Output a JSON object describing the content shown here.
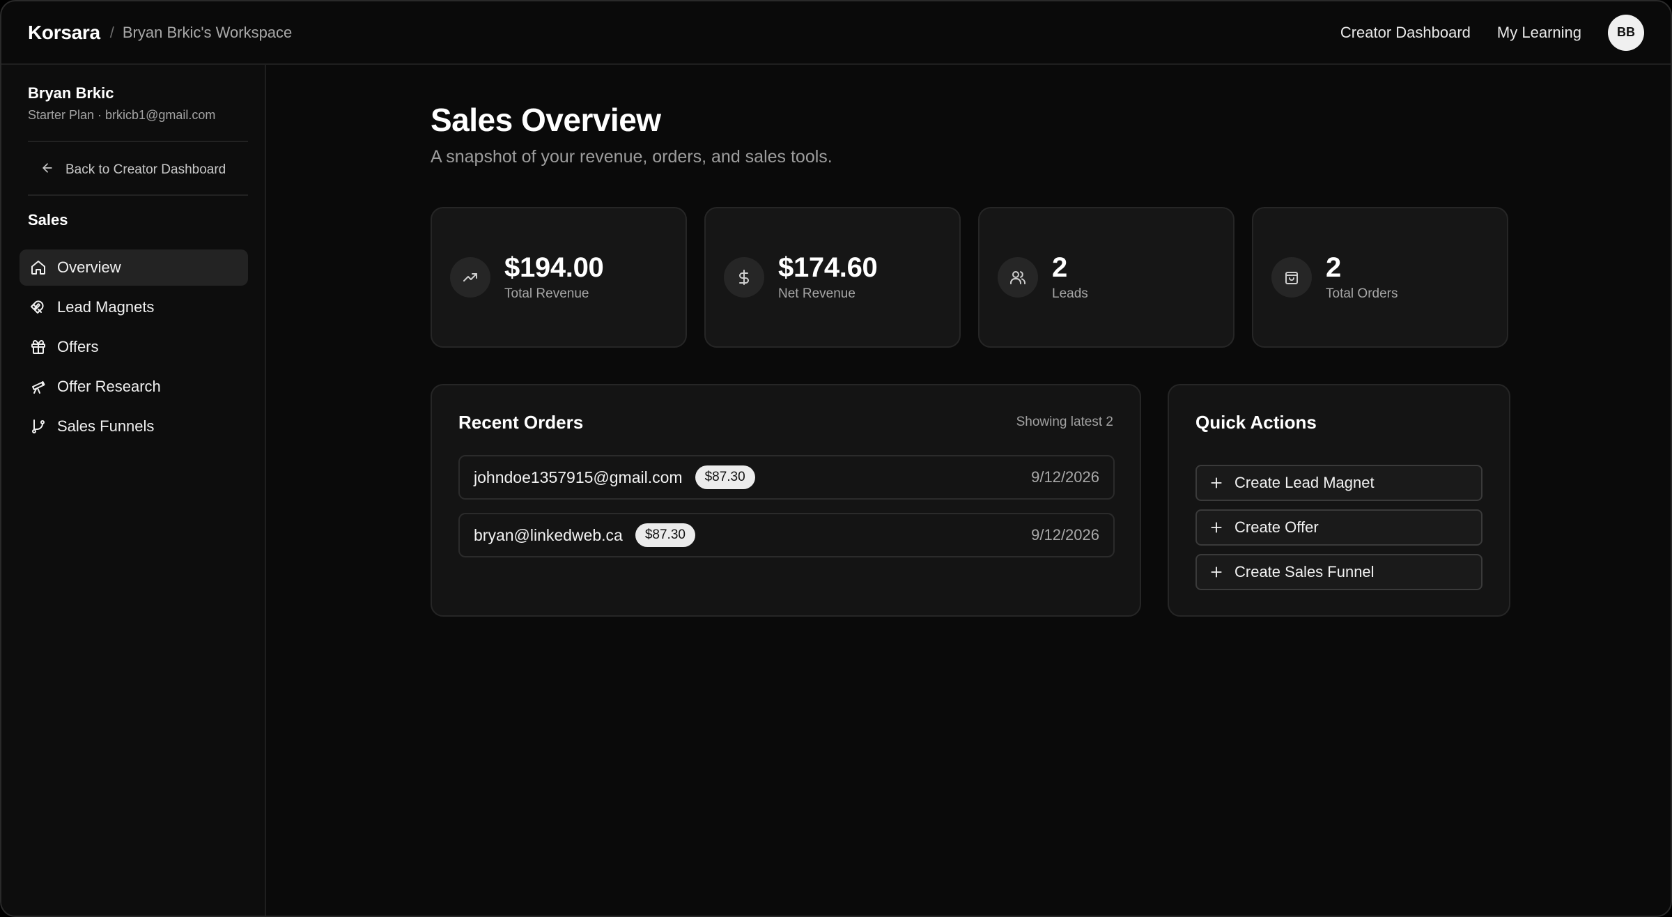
{
  "header": {
    "brand": "Korsara",
    "separator": "/",
    "workspace": "Bryan Brkic's Workspace",
    "nav": [
      "Creator Dashboard",
      "My Learning"
    ],
    "avatar_initials": "BB"
  },
  "sidebar": {
    "user_name": "Bryan Brkic",
    "user_meta": "Starter Plan · brkicb1@gmail.com",
    "back_label": "Back to Creator Dashboard",
    "section_label": "Sales",
    "items": [
      {
        "label": "Overview",
        "icon": "home-icon",
        "active": true
      },
      {
        "label": "Lead Magnets",
        "icon": "magnet-icon",
        "active": false
      },
      {
        "label": "Offers",
        "icon": "gift-icon",
        "active": false
      },
      {
        "label": "Offer Research",
        "icon": "telescope-icon",
        "active": false
      },
      {
        "label": "Sales Funnels",
        "icon": "git-branch-icon",
        "active": false
      }
    ]
  },
  "main": {
    "title": "Sales Overview",
    "subtitle": "A snapshot of your revenue, orders, and sales tools.",
    "stats": [
      {
        "value": "$194.00",
        "label": "Total Revenue",
        "icon": "trending-up-icon"
      },
      {
        "value": "$174.60",
        "label": "Net Revenue",
        "icon": "dollar-icon"
      },
      {
        "value": "2",
        "label": "Leads",
        "icon": "users-icon"
      },
      {
        "value": "2",
        "label": "Total Orders",
        "icon": "shopping-bag-icon"
      }
    ],
    "recent_orders": {
      "title": "Recent Orders",
      "hint": "Showing latest 2",
      "rows": [
        {
          "email": "johndoe1357915@gmail.com",
          "amount": "$87.30",
          "date": "9/12/2026"
        },
        {
          "email": "bryan@linkedweb.ca",
          "amount": "$87.30",
          "date": "9/12/2026"
        }
      ]
    },
    "quick_actions": {
      "title": "Quick Actions",
      "buttons": [
        "Create Lead Magnet",
        "Create Offer",
        "Create Sales Funnel"
      ]
    }
  },
  "colors": {
    "background": "#0a0a0a",
    "card": "#161616",
    "badge": "#ececec",
    "text_muted": "#a6a6a6"
  }
}
